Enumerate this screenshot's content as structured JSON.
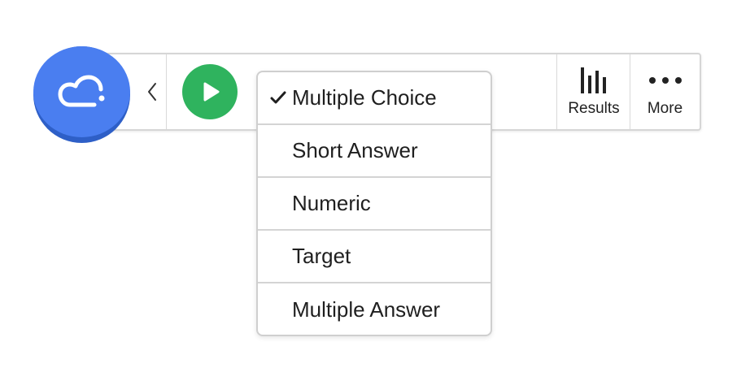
{
  "toolbar": {
    "back_icon": "chevron-left-icon",
    "play_icon": "play-icon",
    "results_label": "Results",
    "more_label": "More"
  },
  "logo": {
    "icon": "cloud-icon",
    "color": "#4a7ef0"
  },
  "question_type_menu": {
    "selected": "Multiple Choice",
    "items": [
      {
        "label": "Multiple Choice",
        "checked": true
      },
      {
        "label": "Short Answer",
        "checked": false
      },
      {
        "label": "Numeric",
        "checked": false
      },
      {
        "label": "Target",
        "checked": false
      },
      {
        "label": "Multiple Answer",
        "checked": false
      }
    ]
  },
  "colors": {
    "play": "#2fb35e",
    "logo": "#4a7ef0",
    "logo_shadow": "#2e5fc7"
  }
}
